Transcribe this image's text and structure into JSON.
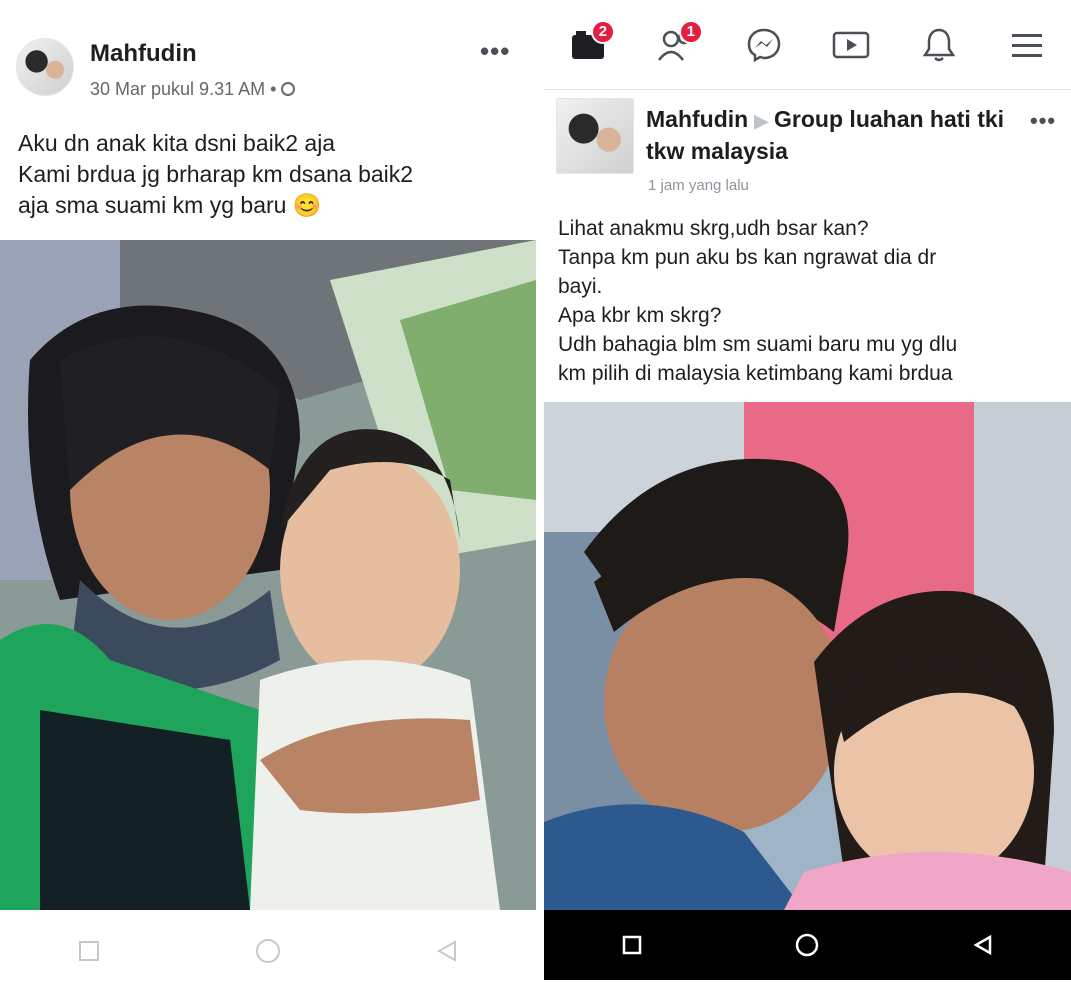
{
  "left": {
    "author": "Mahfudin",
    "timestamp": "30 Mar pukul 9.31 AM • ",
    "more": "•••",
    "text_lines": [
      "Aku dn anak kita dsni baik2 aja",
      "Kami brdua jg brharap km dsana baik2",
      "aja sma suami km yg baru 😊"
    ]
  },
  "right": {
    "top_badges": {
      "friends_requests": "2",
      "notifications_people": "1"
    },
    "author": "Mahfudin",
    "group_line1": "Group luahan hati tki",
    "group_line2": "tkw malaysia",
    "more": "•••",
    "timestamp": "1 jam yang lalu",
    "text_lines": [
      "Lihat anakmu skrg,udh bsar kan?",
      "Tanpa km pun aku bs kan ngrawat dia dr",
      "bayi.",
      "Apa kbr km skrg?",
      "Udh bahagia blm sm suami baru mu yg dlu",
      "km pilih di malaysia ketimbang kami brdua"
    ]
  },
  "icons": {
    "top_bar": [
      "feed-icon",
      "friends-icon",
      "messenger-icon",
      "watch-icon",
      "bell-icon",
      "menu-icon"
    ],
    "nav_bar": [
      "square-icon",
      "circle-icon",
      "back-triangle-icon"
    ]
  }
}
